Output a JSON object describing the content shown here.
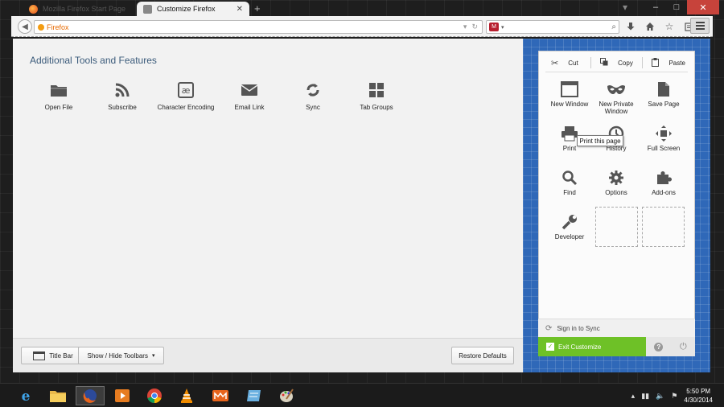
{
  "window": {
    "tabs": [
      {
        "label": "Mozilla Firefox Start Page",
        "active": false
      },
      {
        "label": "Customize Firefox",
        "active": true
      }
    ],
    "new_tab_symbol": "+",
    "controls": {
      "minimize": "–",
      "maximize": "□",
      "close": "✕"
    }
  },
  "navbar": {
    "identity_label": "Firefox",
    "url_value": "",
    "search_value": ""
  },
  "palette": {
    "title": "Additional Tools and Features",
    "items": [
      {
        "label": "Open File",
        "icon": "folder-icon"
      },
      {
        "label": "Subscribe",
        "icon": "rss-icon"
      },
      {
        "label": "Character Encoding",
        "icon": "character-encoding-icon"
      },
      {
        "label": "Email Link",
        "icon": "envelope-icon"
      },
      {
        "label": "Sync",
        "icon": "sync-icon"
      },
      {
        "label": "Tab Groups",
        "icon": "tab-groups-icon"
      }
    ]
  },
  "bottom_bar": {
    "title_bar_label": "Title Bar",
    "toolbars_label": "Show / Hide Toolbars",
    "restore_label": "Restore Defaults"
  },
  "menu_panel": {
    "edit": {
      "cut": "Cut",
      "copy": "Copy",
      "paste": "Paste"
    },
    "items": [
      {
        "label_1": "New Window",
        "label_2": "",
        "icon": "new-window-icon"
      },
      {
        "label_1": "New Private",
        "label_2": "Window",
        "icon": "private-mask-icon"
      },
      {
        "label_1": "Save Page",
        "label_2": "",
        "icon": "save-page-icon"
      },
      {
        "label_1": "Print",
        "label_2": "",
        "icon": "printer-icon"
      },
      {
        "label_1": "History",
        "label_2": "",
        "icon": "history-clock-icon"
      },
      {
        "label_1": "Full Screen",
        "label_2": "",
        "icon": "fullscreen-icon"
      },
      {
        "label_1": "Find",
        "label_2": "",
        "icon": "magnifier-icon"
      },
      {
        "label_1": "Options",
        "label_2": "",
        "icon": "gear-icon"
      },
      {
        "label_1": "Add-ons",
        "label_2": "",
        "icon": "puzzle-icon"
      },
      {
        "label_1": "Developer",
        "label_2": "",
        "icon": "wrench-icon"
      }
    ],
    "tooltip": "Print this page",
    "sync_label": "Sign in to Sync",
    "exit_label": "Exit Customize"
  },
  "taskbar": {
    "apps": [
      "internet-explorer-icon",
      "file-explorer-icon",
      "firefox-icon",
      "media-player-icon",
      "chrome-icon",
      "vlc-icon",
      "micromax-icon",
      "notes-icon",
      "paint-icon"
    ],
    "time": "5:50 PM",
    "date": "4/30/2014"
  }
}
